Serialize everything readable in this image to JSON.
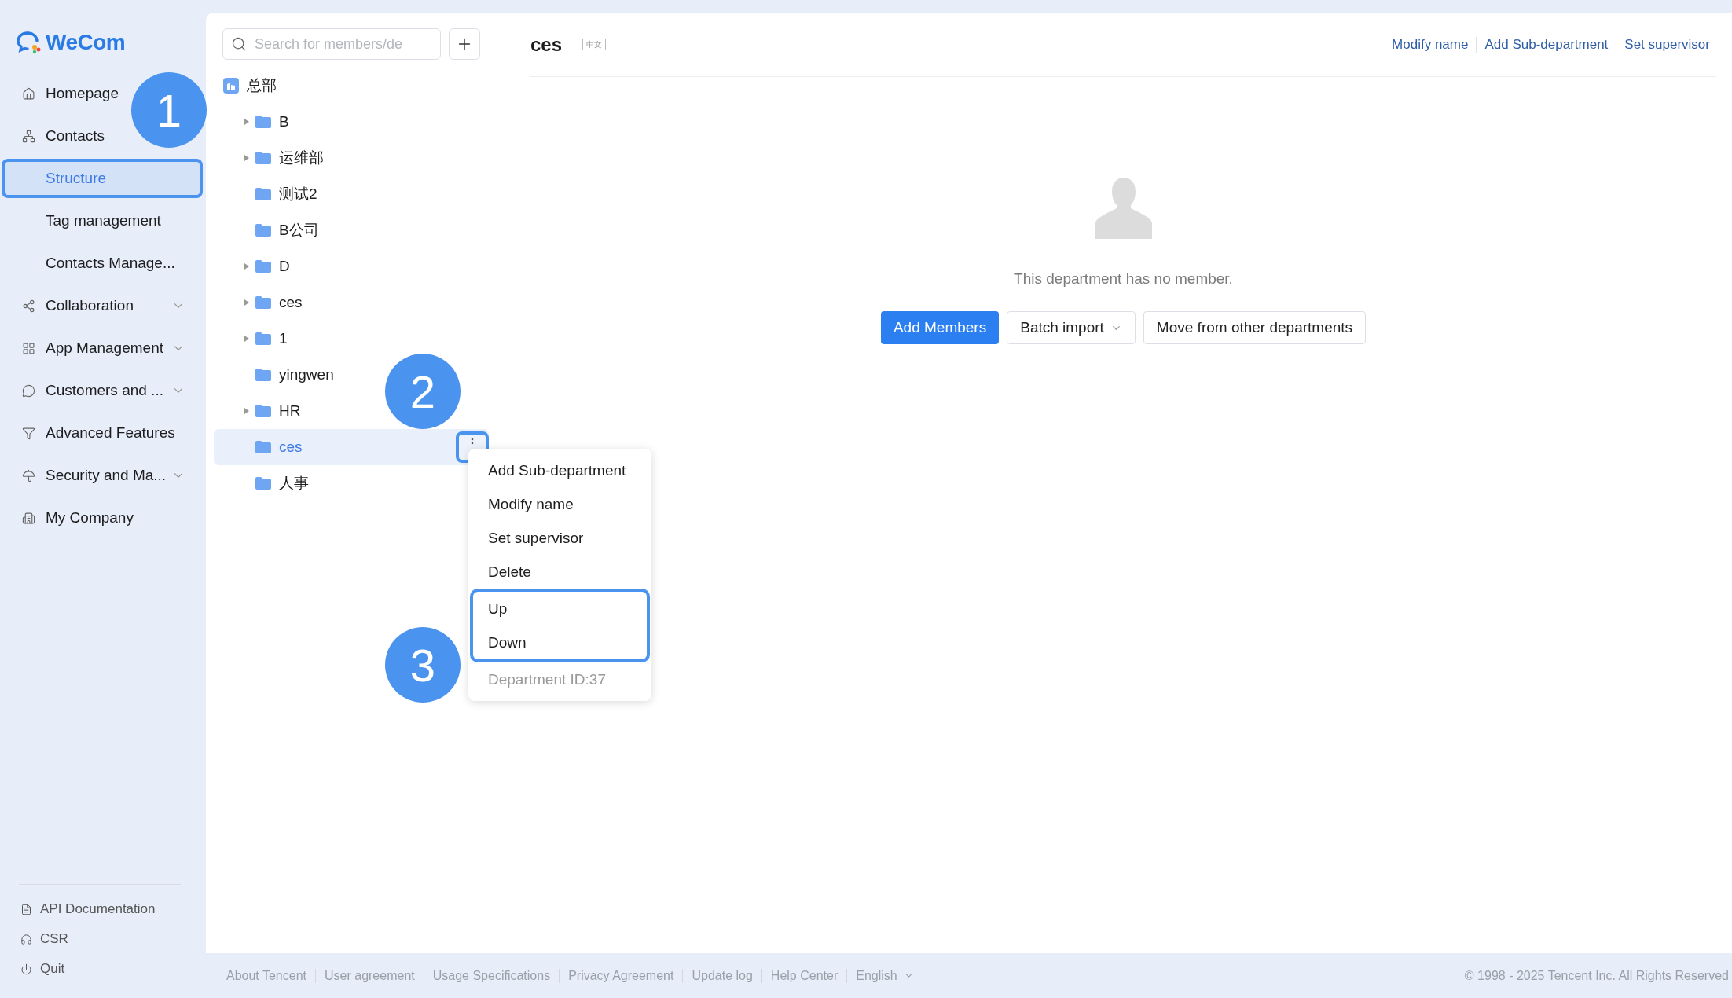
{
  "logo": {
    "text": "WeCom"
  },
  "sidebar": {
    "items": [
      {
        "kind": "section",
        "label": "Homepage",
        "expandable": false
      },
      {
        "kind": "section",
        "label": "Contacts",
        "expandable": false
      },
      {
        "kind": "subitem",
        "label": "Structure",
        "selected": true
      },
      {
        "kind": "subitem",
        "label": "Tag management",
        "selected": false
      },
      {
        "kind": "subitem",
        "label": "Contacts Manage...",
        "selected": false
      },
      {
        "kind": "section",
        "label": "Collaboration",
        "expandable": true
      },
      {
        "kind": "section",
        "label": "App Management",
        "expandable": true
      },
      {
        "kind": "section",
        "label": "Customers and ...",
        "expandable": true
      },
      {
        "kind": "section",
        "label": "Advanced Features",
        "expandable": false
      },
      {
        "kind": "section",
        "label": "Security and Ma...",
        "expandable": true
      },
      {
        "kind": "section",
        "label": "My Company",
        "expandable": false
      }
    ],
    "bottom_items": [
      "API Documentation",
      "CSR",
      "Quit"
    ]
  },
  "tree": {
    "search": {
      "placeholder": "Search for members/de"
    },
    "root": {
      "label": "总部",
      "children": [
        {
          "label": "B",
          "expandable": true,
          "selected": false
        },
        {
          "label": "运维部",
          "expandable": true,
          "selected": false
        },
        {
          "label": "测试2",
          "expandable": false,
          "selected": false
        },
        {
          "label": "B公司",
          "expandable": false,
          "selected": false
        },
        {
          "label": "D",
          "expandable": true,
          "selected": false
        },
        {
          "label": "ces",
          "expandable": true,
          "selected": false
        },
        {
          "label": "1",
          "expandable": true,
          "selected": false
        },
        {
          "label": "yingwen",
          "expandable": false,
          "selected": false
        },
        {
          "label": "HR",
          "expandable": true,
          "selected": false
        },
        {
          "label": "ces",
          "expandable": false,
          "selected": true
        },
        {
          "label": "人事",
          "expandable": false,
          "selected": false
        }
      ]
    }
  },
  "context_menu": {
    "more_button_highlighted": true,
    "sections": [
      {
        "highlighted": false,
        "items": [
          "Add Sub-department",
          "Modify name",
          "Set supervisor",
          "Delete"
        ]
      },
      {
        "highlighted": true,
        "items": [
          "Up",
          "Down"
        ]
      }
    ],
    "footer": "Department ID:37"
  },
  "department": {
    "name": "ces",
    "language_tag": "中文",
    "actions": [
      "Modify name",
      "Add Sub-department",
      "Set supervisor"
    ],
    "empty_message": "This department has no member.",
    "buttons": [
      {
        "kind": "primary",
        "label": "Add Members"
      },
      {
        "kind": "dropdown",
        "label": "Batch import"
      },
      {
        "kind": "default",
        "label": "Move from other departments"
      }
    ]
  },
  "annotations": [
    "1",
    "2",
    "3"
  ],
  "footer": {
    "links": [
      "About Tencent",
      "User agreement",
      "Usage Specifications",
      "Privacy Agreement",
      "Update log",
      "Help Center"
    ],
    "language": "English",
    "copyright": "© 1998 - 2025 Tencent Inc. All Rights Reserved"
  }
}
